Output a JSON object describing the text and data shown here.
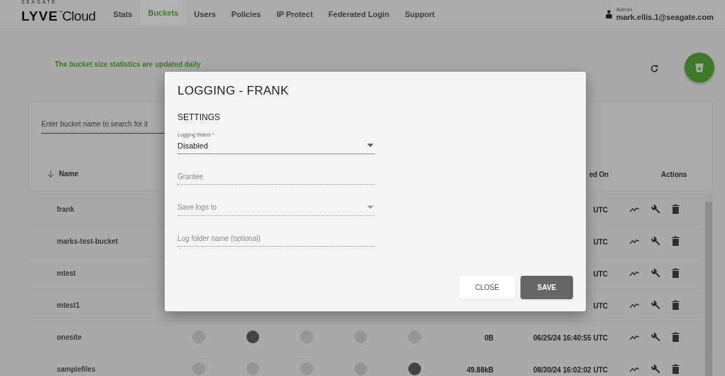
{
  "header": {
    "brand": "SEAGATE",
    "logo": "**LYVE**$^{™}$Cloud",
    "nav": [
      {
        "label": "Stats",
        "selected": false
      },
      {
        "label": "Buckets",
        "selected": true
      },
      {
        "label": "Users",
        "selected": false
      },
      {
        "label": "Policies",
        "selected": false
      },
      {
        "label": "IP Protect",
        "selected": false
      },
      {
        "label": "Federated Login",
        "selected": false
      },
      {
        "label": "Support",
        "selected": false
      }
    ],
    "user": {
      "role": "Admin",
      "email": "mark.ellis.1@seagate.com"
    }
  },
  "notice": "The bucket size statistics are updated daily",
  "search": {
    "placeholder": "Enter bucket name to search for it"
  },
  "table": {
    "columns": [
      {
        "label": "Name"
      },
      {
        "label": "ed On"
      },
      {
        "label": "Actions"
      }
    ],
    "rows": [
      {
        "name": "frank",
        "date": "UTC"
      },
      {
        "name": "marks-test-bucket",
        "date": "UTC"
      },
      {
        "name": "mtest",
        "date": "UTC"
      },
      {
        "name": "mtest1",
        "date": "UTC"
      },
      {
        "name": "onesite",
        "flags": [
          false,
          true,
          false,
          false,
          false
        ],
        "size": "0B",
        "date": "06/25/24 16:40:55 UTC"
      },
      {
        "name": "samplefiles",
        "flags": [
          false,
          false,
          false,
          false,
          true
        ],
        "size": "49.88kB",
        "date": "08/30/24 16:02:02 UTC"
      }
    ]
  },
  "modal": {
    "title": "LOGGING - FRANK",
    "section": "SETTINGS",
    "fields": [
      {
        "kind": "select",
        "label": "Logging Status *",
        "value": "Disabled",
        "disabled": false
      },
      {
        "kind": "input",
        "placeholder": "Grantee",
        "disabled": true
      },
      {
        "kind": "select",
        "placeholder": "Save logs to",
        "disabled": true
      },
      {
        "kind": "input",
        "placeholder": "Log folder name (optional)",
        "disabled": true
      }
    ],
    "buttons": [
      {
        "label": "CLOSE",
        "kind": "secondary"
      },
      {
        "label": "SAVE",
        "kind": "primary"
      }
    ]
  }
}
